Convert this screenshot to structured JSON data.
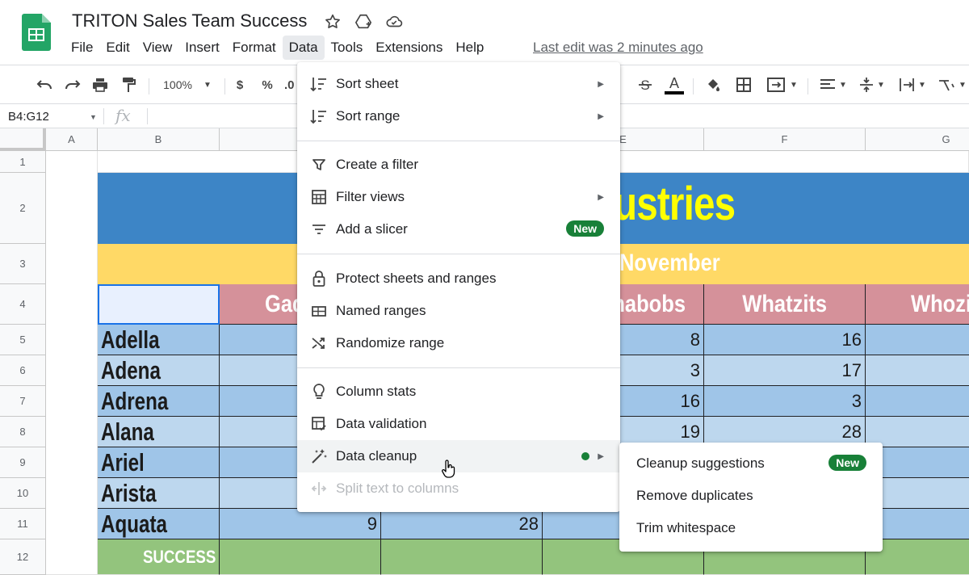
{
  "doc": {
    "title": "TRITON Sales Team Success"
  },
  "menu_bar": [
    "File",
    "Edit",
    "View",
    "Insert",
    "Format",
    "Data",
    "Tools",
    "Extensions",
    "Help"
  ],
  "last_edit": "Last edit was 2 minutes ago",
  "toolbar": {
    "zoom": "100%",
    "currency": "$",
    "percent": "%",
    "decimal": ".0"
  },
  "formula_bar": {
    "cell_ref": "B4:G12",
    "fx": "fx"
  },
  "columns": [
    "A",
    "B",
    "E",
    "F",
    "G"
  ],
  "rows": [
    "1",
    "2",
    "3",
    "4",
    "5",
    "6",
    "7",
    "8",
    "9",
    "10",
    "11",
    "12"
  ],
  "sheet": {
    "banner_text": "ustries",
    "subtitle_text": "November",
    "headers": [
      "Gad",
      "mabobs",
      "Whatzits",
      "Whozit"
    ],
    "names": [
      "Adella",
      "Adena",
      "Adrena",
      "Alana",
      "Ariel",
      "Arista",
      "Aquata"
    ],
    "col_e": [
      "8",
      "3",
      "16",
      "19"
    ],
    "col_f": [
      "16",
      "17",
      "3",
      "28"
    ],
    "row11_c": "9",
    "row11_d": "28",
    "success_label": "SUCCESS"
  },
  "data_menu": {
    "items": [
      "Sort sheet",
      "Sort range",
      "Create a filter",
      "Filter views",
      "Add a slicer",
      "Protect sheets and ranges",
      "Named ranges",
      "Randomize range",
      "Column stats",
      "Data validation",
      "Data cleanup",
      "Split text to columns"
    ],
    "new_badge": "New"
  },
  "cleanup_submenu": {
    "items": [
      "Cleanup suggestions",
      "Remove duplicates",
      "Trim whitespace"
    ],
    "new_badge": "New"
  },
  "colors": {
    "banner_blue": "#3d85c6",
    "banner_yellow": "#ffd966",
    "header_pink": "#d5919a",
    "row_blue": "#9fc5e8",
    "row_lightblue": "#bdd7ee",
    "success_green": "#93c47d",
    "badge_green": "#188038",
    "title_yellow": "#ffff00"
  }
}
